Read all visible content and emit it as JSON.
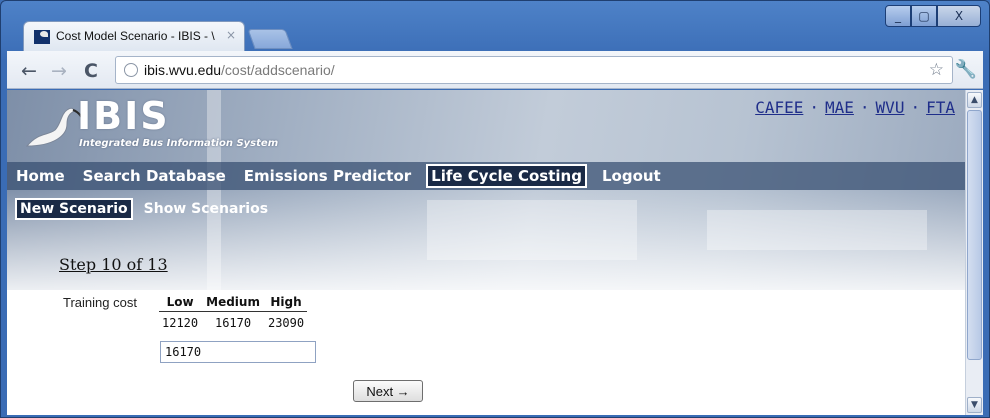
{
  "browser": {
    "tab_title": "Cost Model Scenario - IBIS - \\",
    "tab_close": "×",
    "url_host": "ibis.wvu.edu",
    "url_path": "/cost/addscenario/",
    "controls": {
      "minimize": "_",
      "maximize": "▢",
      "close": "X"
    },
    "icons": [
      "back-arrow-icon",
      "forward-arrow-icon",
      "reload-icon",
      "globe-icon",
      "star-icon",
      "wrench-icon"
    ]
  },
  "header": {
    "logo_word": "IBIS",
    "logo_sub": "Integrated Bus Information System",
    "partners": [
      "CAFEE",
      "MAE",
      "WVU",
      "FTA"
    ],
    "partner_separator": "·"
  },
  "main_nav": [
    {
      "label": "Home",
      "active": false
    },
    {
      "label": "Search Database",
      "active": false
    },
    {
      "label": "Emissions Predictor",
      "active": false
    },
    {
      "label": "Life Cycle Costing",
      "active": true
    },
    {
      "label": "Logout",
      "active": false
    }
  ],
  "sub_nav": [
    {
      "label": "New Scenario",
      "active": true
    },
    {
      "label": "Show Scenarios",
      "active": false
    }
  ],
  "step": {
    "label": "Step 10 of 13"
  },
  "form": {
    "field_label": "Training cost",
    "columns": [
      "Low",
      "Medium",
      "High"
    ],
    "values": [
      "12120",
      "16170",
      "23090"
    ],
    "input_value": "16170",
    "next_label": "Next →"
  },
  "colors": {
    "nav_bg": "#364e70",
    "active_nav_bg": "#1a2a46",
    "partner_link": "#1f2e8a",
    "window_frame": "#3d6fb6"
  }
}
